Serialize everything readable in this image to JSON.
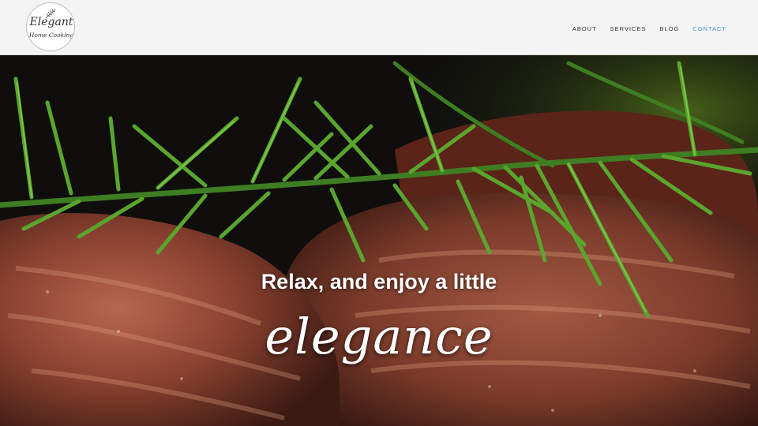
{
  "header": {
    "logo": {
      "line1": "Elegant",
      "line2": "Home Cooking"
    },
    "nav": [
      {
        "label": "ABOUT"
      },
      {
        "label": "SERVICES"
      },
      {
        "label": "BLOG"
      },
      {
        "label": "CONTACT",
        "active": true
      }
    ],
    "active_color": "#3d9bd9"
  },
  "hero": {
    "tagline": "Relax, and enjoy a little",
    "script_word": "elegance",
    "background": "grilled-steak-with-rosemary-photo"
  }
}
